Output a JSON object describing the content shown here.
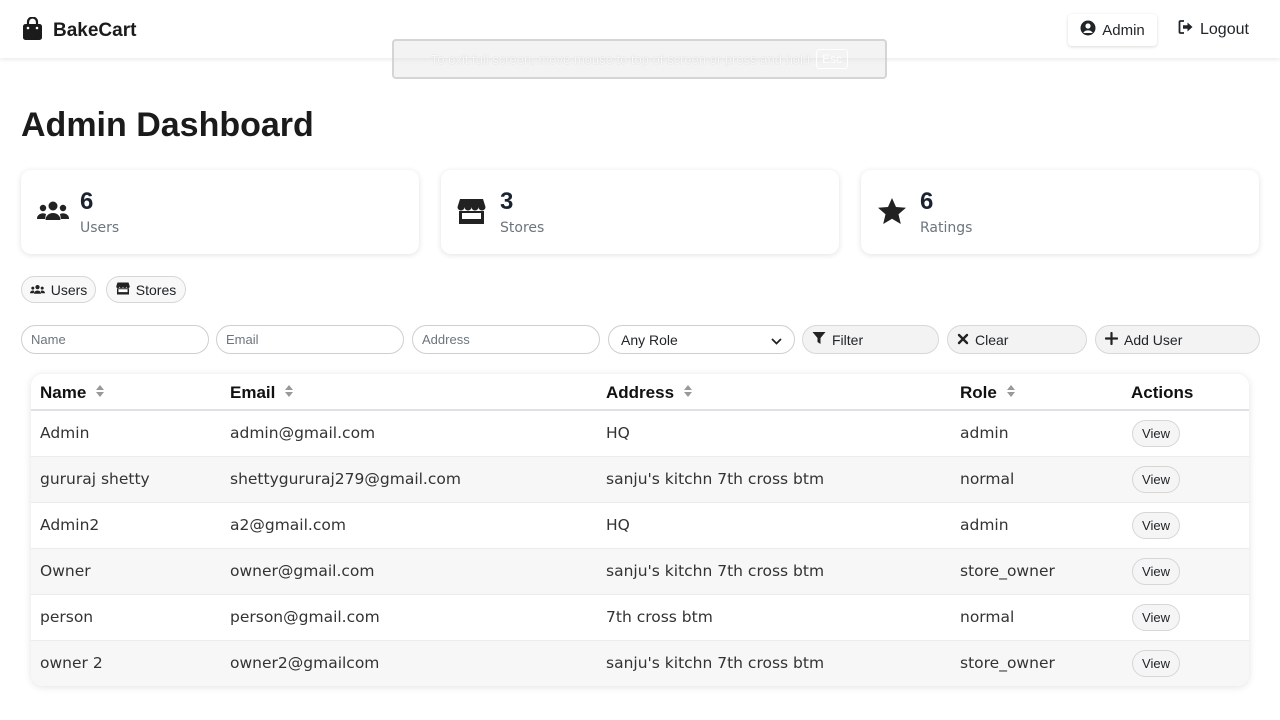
{
  "navbar": {
    "brand": "BakeCart",
    "admin_label": "Admin",
    "logout_label": "Logout"
  },
  "fullscreen_notice": {
    "text": "To exit full screen, move mouse to top of screen or press and hold",
    "key": "Esc"
  },
  "page_title": "Admin Dashboard",
  "stats": [
    {
      "value": "6",
      "label": "Users",
      "icon": "users-icon"
    },
    {
      "value": "3",
      "label": "Stores",
      "icon": "store-icon"
    },
    {
      "value": "6",
      "label": "Ratings",
      "icon": "star-icon"
    }
  ],
  "tabs": [
    {
      "label": "Users",
      "icon": "users-icon"
    },
    {
      "label": "Stores",
      "icon": "store-icon"
    }
  ],
  "filters": {
    "name_placeholder": "Name",
    "email_placeholder": "Email",
    "address_placeholder": "Address",
    "role_selected": "Any Role",
    "filter_label": "Filter",
    "clear_label": "Clear",
    "add_user_label": "Add User"
  },
  "table": {
    "headers": [
      "Name",
      "Email",
      "Address",
      "Role",
      "Actions"
    ],
    "rows": [
      {
        "name": "Admin",
        "email": "admin@gmail.com",
        "address": "HQ",
        "role": "admin",
        "action": "View"
      },
      {
        "name": "gururaj shetty",
        "email": "shettygururaj279@gmail.com",
        "address": "sanju's kitchn 7th cross btm",
        "role": "normal",
        "action": "View"
      },
      {
        "name": "Admin2",
        "email": "a2@gmail.com",
        "address": "HQ",
        "role": "admin",
        "action": "View"
      },
      {
        "name": "Owner",
        "email": "owner@gmail.com",
        "address": "sanju's kitchn 7th cross btm",
        "role": "store_owner",
        "action": "View"
      },
      {
        "name": "person",
        "email": "person@gmail.com",
        "address": "7th cross btm",
        "role": "normal",
        "action": "View"
      },
      {
        "name": "owner 2",
        "email": "owner2@gmailcom",
        "address": "sanju's kitchn 7th cross btm",
        "role": "store_owner",
        "action": "View"
      }
    ]
  },
  "colors": {
    "text_dark": "#1b1b1b",
    "muted": "#6c757d",
    "card_bg": "#ffffff",
    "button_bg": "#f3f3f3"
  }
}
